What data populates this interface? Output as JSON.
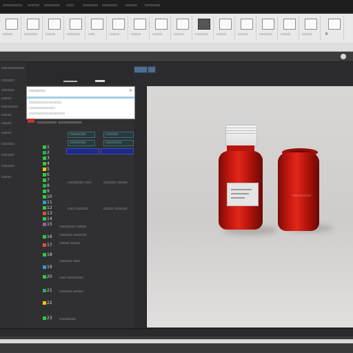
{
  "menubar": {
    "items": [
      "▭▭▭▭▭",
      "▭▭▭",
      "▭▭▭▭",
      "▭▭",
      "▭▭▭▭",
      "▭▭▭▭",
      "▭▭▭",
      "▭▭▭▭"
    ]
  },
  "ribbon": {
    "groups": [
      "▭▭▭",
      "▭▭▭▭",
      "▭▭▭",
      "▭▭▭▭",
      "▭▭",
      "▭▭▭",
      "▭▭▭",
      "▭▭▭",
      "▭▭▭",
      "▭▭▭▭",
      "▭▭▭",
      "▭▭▭",
      "▭▭▭▭",
      "▭▭▭",
      "▭▭▭",
      "B"
    ]
  },
  "sidebar": {
    "items": [
      "▭▭▭▭▭▭▭",
      "▭▭▭▭",
      "▭▭▭▭",
      "▭▭▭",
      "▭▭▭▭▭",
      "▭▭▭",
      "▭▭▭",
      "▭▭▭",
      "▭▭▭▭",
      "▭▭▭▭",
      "▭▭▭▭",
      "▭▭▭"
    ]
  },
  "popup": {
    "title": "▭▭▭▭▭",
    "rows": [
      "▭▭▭▭▭▭▭▭▭▭",
      "▭▭▭▭▭▭▭▭",
      "▭▭▭▭▭▭▭▭▭▭▭"
    ]
  },
  "panel": {
    "header": "▭▭▭▭▭ ▭▭▭▭▭▭",
    "fields_top": [
      "▭▭▭▭▭",
      "▭▭▭▭",
      "▭▭▭▭▭",
      "▭▭▭▭▭"
    ],
    "row_numbers": [
      "1",
      "2",
      "3",
      "4",
      "5",
      "6",
      "7",
      "8",
      "9",
      "10",
      "11",
      "12",
      "13",
      "14",
      "15",
      "16",
      "17",
      "18",
      "19",
      "20",
      "21",
      "22",
      "23"
    ],
    "props": [
      "▭▭▭▭▭ ▭▭",
      "▭▭▭▭ ▭▭▭",
      "▭▭ ▭▭▭▭",
      "▭▭▭ ▭▭▭▭",
      "▭▭▭▭▭ ▭▭▭",
      "▭▭▭▭ ▭▭▭▭",
      "▭▭▭ ▭▭▭",
      "▭▭▭▭ ▭▭",
      "▭▭ ▭▭▭▭▭",
      "▭▭▭▭ ▭▭▭",
      "▭▭▭▭▭"
    ]
  },
  "viewport": {
    "label_text": "▭▭▭▭▭▭"
  },
  "colors": {
    "accent": "#3b4db8",
    "bottle_red": "#c2170e",
    "cap_white": "#f2f2f2",
    "teal_field": "#243a3e"
  }
}
